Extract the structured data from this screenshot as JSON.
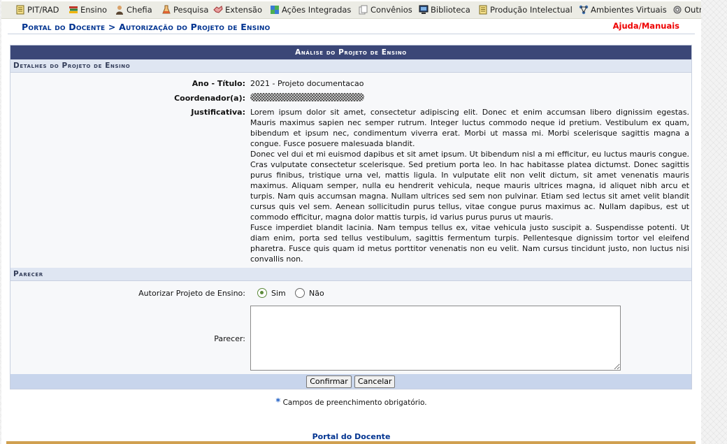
{
  "menu": [
    {
      "label": "PIT/RAD",
      "icon": "notepad-icon"
    },
    {
      "label": "Ensino",
      "icon": "books-icon"
    },
    {
      "label": "Chefia",
      "icon": "person-icon"
    },
    {
      "label": "Pesquisa",
      "icon": "flask-icon"
    },
    {
      "label": "Extensão",
      "icon": "hands-icon"
    },
    {
      "label": "Ações Integradas",
      "icon": "puzzle-icon"
    },
    {
      "label": "Convênios",
      "icon": "documents-icon"
    },
    {
      "label": "Biblioteca",
      "icon": "monitor-book-icon"
    },
    {
      "label": "Produção Intelectual",
      "icon": "notepad-icon"
    },
    {
      "label": "Ambientes Virtuais",
      "icon": "network-icon"
    },
    {
      "label": "Outros",
      "icon": "gears-icon"
    }
  ],
  "breadcrumb": "Portal do Docente > Autorização do Projeto de Ensino",
  "help_link": "Ajuda/Manuais",
  "form": {
    "caption": "Análise do Projeto de Ensino",
    "details_header": "Detalhes do Projeto de Ensino",
    "ano_titulo_label": "Ano - Título:",
    "ano_titulo_value": "2021 - Projeto documentacao",
    "coordenador_label": "Coordenador(a):",
    "justificativa_label": "Justificativa:",
    "justificativa_paragraphs": [
      "Lorem ipsum dolor sit amet, consectetur adipiscing elit. Donec et enim accumsan libero dignissim egestas. Mauris maximus sapien nec semper rutrum. Integer luctus commodo neque id pretium. Vestibulum ex quam, bibendum et ipsum nec, condimentum viverra erat. Morbi ut massa mi. Morbi scelerisque sagittis magna a congue. Fusce posuere malesuada blandit.",
      "Donec vel dui et mi euismod dapibus et sit amet ipsum. Ut bibendum nisl a mi efficitur, eu luctus mauris congue. Cras vulputate consectetur scelerisque. Sed pretium porta leo. In hac habitasse platea dictumst. Donec sagittis purus finibus, tristique urna vel, mattis ligula. In vulputate elit non velit dictum, sit amet venenatis mauris maximus. Aliquam semper, nulla eu hendrerit vehicula, neque mauris ultrices magna, id aliquet nibh arcu et turpis. Nam quis accumsan magna. Nullam ultrices sed sem non pulvinar. Etiam sed lectus sit amet velit blandit cursus quis vel sem. Aenean sollicitudin purus tellus, vitae congue purus maximus ac. Nullam dapibus, est ut commodo efficitur, magna dolor mattis turpis, id varius purus purus ut mauris.",
      "Fusce imperdiet blandit lacinia. Nam tempus tellus ex, vitae vehicula justo suscipit a. Suspendisse potenti. Ut diam enim, porta sed tellus vestibulum, sagittis fermentum turpis. Pellentesque dignissim tortor vel eleifend pharetra. Fusce quis quam id metus porttitor venenatis non eu velit. Nam cursus tincidunt justo, non luctus nisi convallis non."
    ],
    "parecer_header": "Parecer",
    "autorizar_label": "Autorizar Projeto de Ensino:",
    "option_sim": "Sim",
    "option_nao": "Não",
    "selected_option": "Sim",
    "parecer_label": "Parecer:",
    "parecer_value": "",
    "confirm_label": "Confirmar",
    "cancel_label": "Cancelar"
  },
  "required_note": "Campos de preenchimento obrigatório.",
  "required_star": "*",
  "footer_link": "Portal do Docente"
}
